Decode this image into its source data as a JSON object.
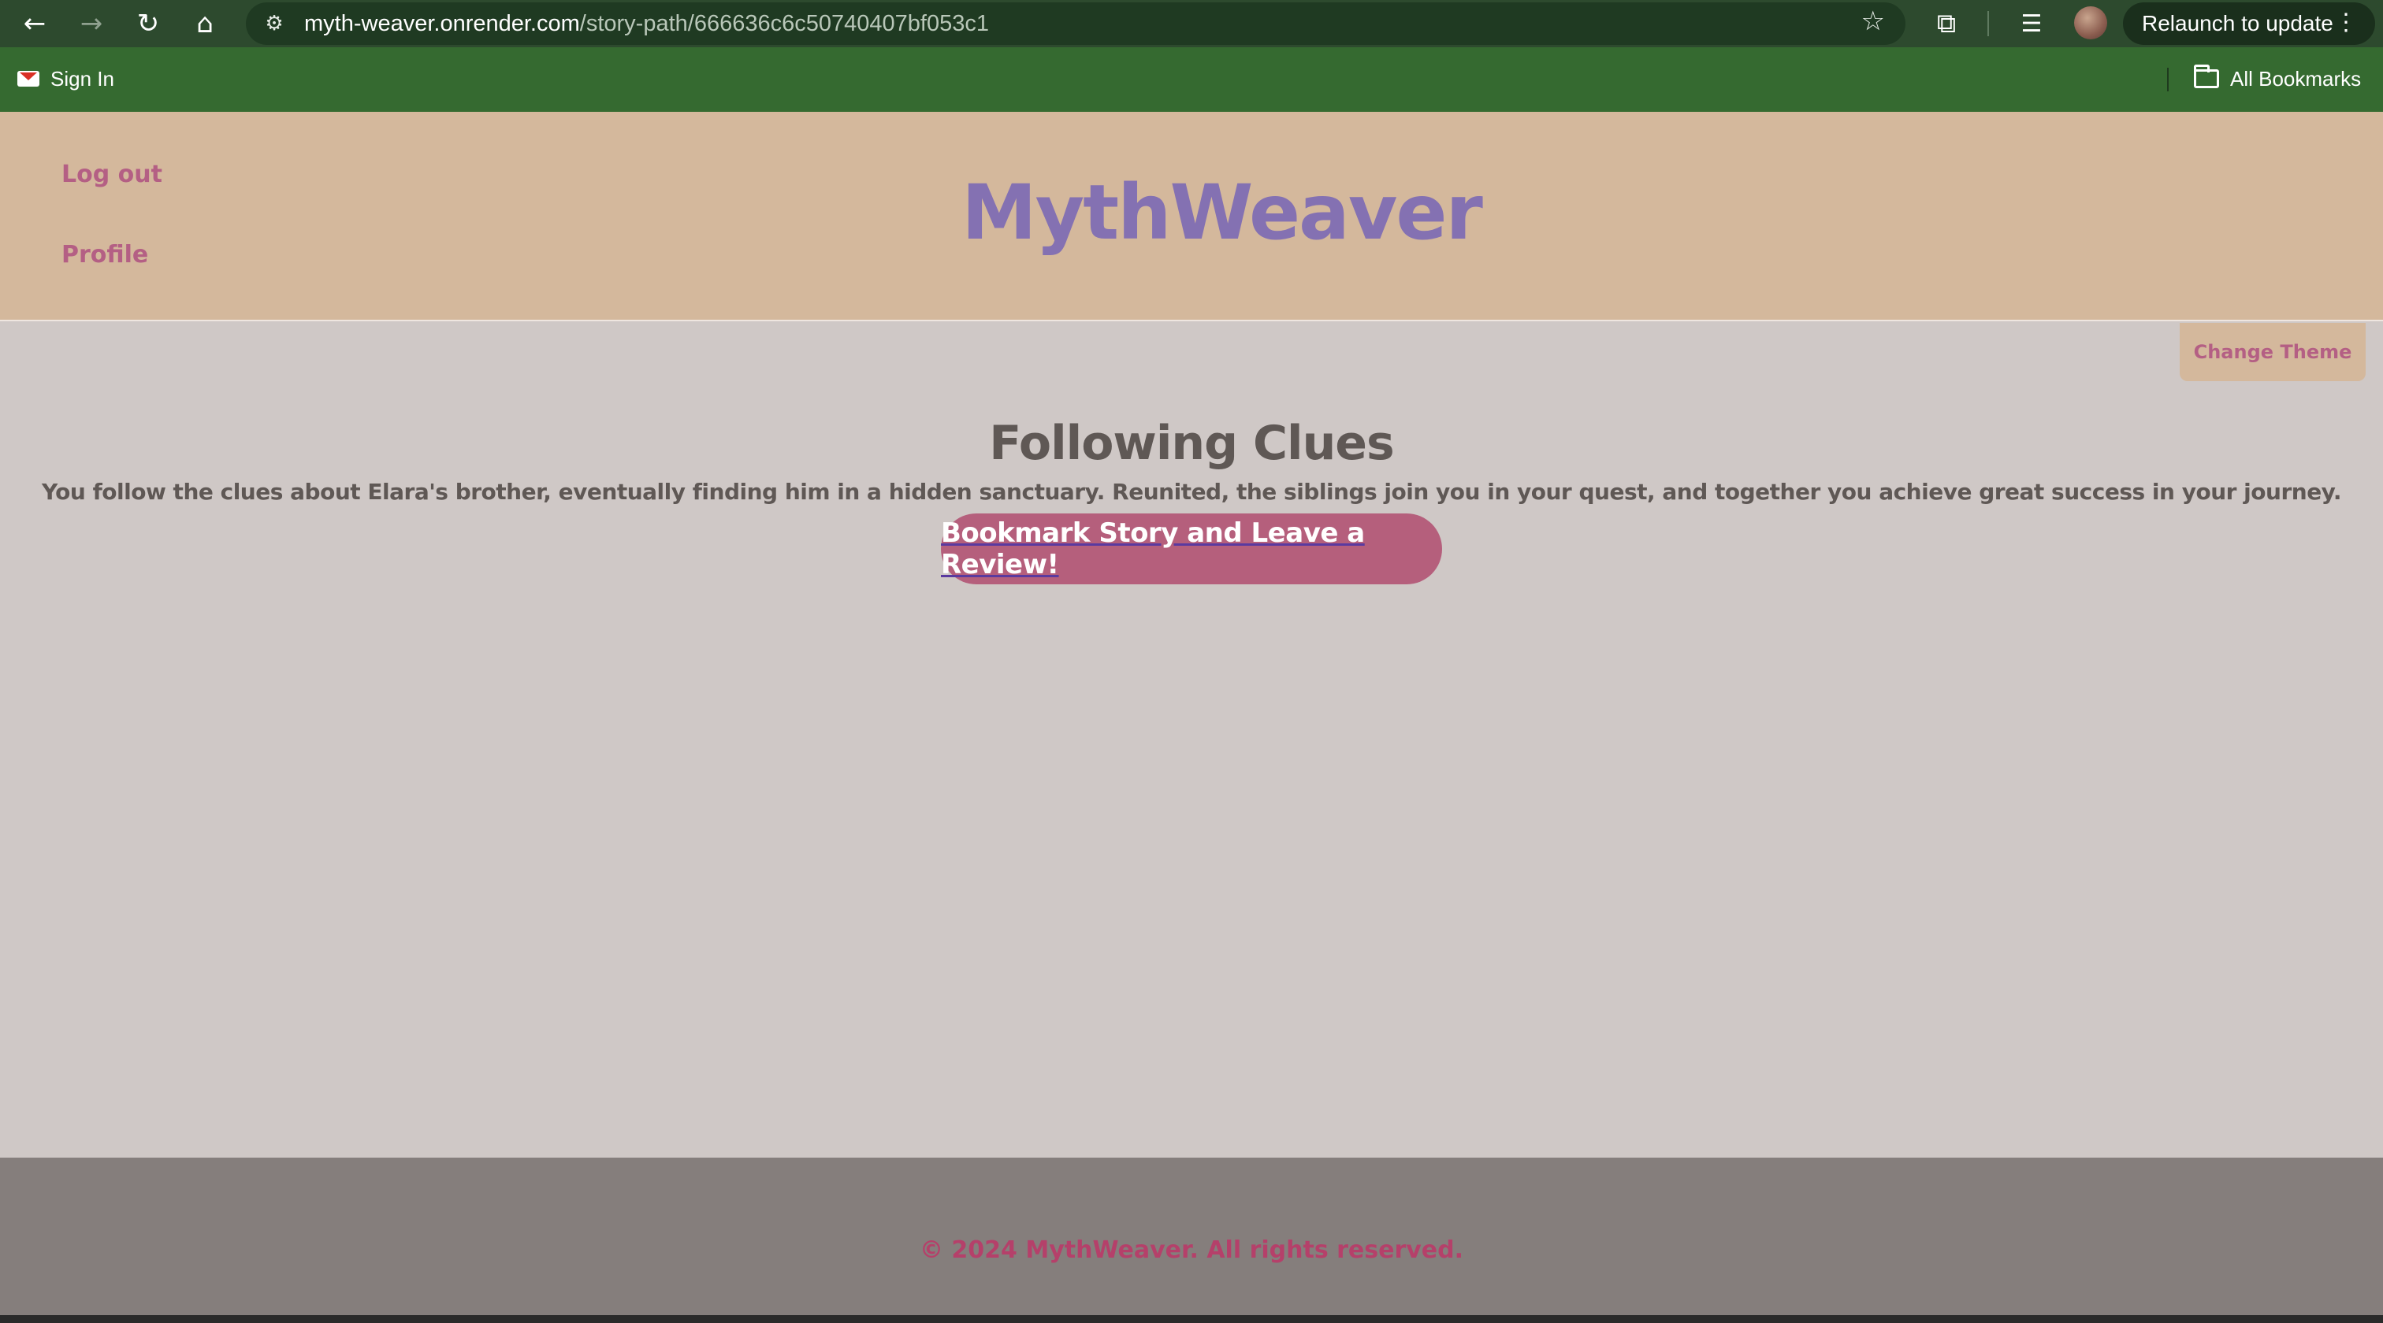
{
  "browser": {
    "url_host": "myth-weaver.onrender.com",
    "url_path": "/story-path/666636c6c50740407bf053c1",
    "relaunch_label": "Relaunch to update",
    "icons": {
      "back": "←",
      "forward": "→",
      "reload": "↻",
      "home": "⌂",
      "site_settings": "⚙",
      "bookmark_star": "☆",
      "extensions": "⧉",
      "reading_list": "☰",
      "menu": "⋮"
    }
  },
  "bookmarks_bar": {
    "sign_in_label": "Sign In",
    "all_bookmarks_label": "All Bookmarks"
  },
  "header": {
    "logout_label": "Log out",
    "profile_label": "Profile",
    "logo": "MythWeaver"
  },
  "theme": {
    "change_theme_label": "Change Theme"
  },
  "story": {
    "title": "Following Clues",
    "text": "You follow the clues about Elara's brother, eventually finding him in a hidden sanctuary. Reunited, the siblings join you in your quest, and together you achieve great success in your journey.",
    "cta_label": "Bookmark Story and Leave a Review!"
  },
  "footer": {
    "copyright": "© 2024 MythWeaver. All rights reserved."
  },
  "colors": {
    "header_bg": "#d4b89c",
    "logo": "#8471b2",
    "accent_pink": "#b45f84",
    "page_bg": "#cfc8c6",
    "footer_bg": "#857e7c"
  }
}
